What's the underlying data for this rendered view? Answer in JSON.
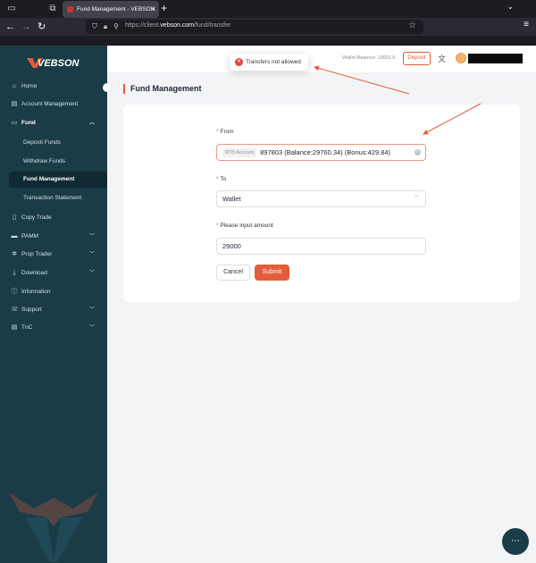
{
  "browser": {
    "tab_title": "Fund Management - VEBSON",
    "url_prefix": "https://client.",
    "url_domain": "vebson.com",
    "url_path": "/fund/transfer"
  },
  "sidebar": {
    "logo_text": "VEBSON",
    "items": [
      {
        "label": "Home",
        "icon": "home-icon"
      },
      {
        "label": "Account Management",
        "icon": "account-icon"
      },
      {
        "label": "Fund",
        "icon": "fund-icon",
        "expanded": true
      },
      {
        "label": "Deposit Funds"
      },
      {
        "label": "Withdraw Funds"
      },
      {
        "label": "Fund Management",
        "active": true
      },
      {
        "label": "Transaction Statement"
      },
      {
        "label": "Copy Trade",
        "icon": "copy-icon"
      },
      {
        "label": "PAMM",
        "icon": "pamm-icon"
      },
      {
        "label": "Prop Trader",
        "icon": "prop-icon"
      },
      {
        "label": "Download",
        "icon": "download-icon"
      },
      {
        "label": "Information",
        "icon": "info-icon"
      },
      {
        "label": "Support",
        "icon": "support-icon"
      },
      {
        "label": "TnC",
        "icon": "tnc-icon"
      }
    ]
  },
  "header": {
    "wallet_balance": "Wallet Balance: 10601.6",
    "deposit_label": "Deposit",
    "user_name": "redacted"
  },
  "toast": {
    "message": "Transfers not allowed"
  },
  "page": {
    "title": "Fund Management"
  },
  "form": {
    "from_label": "From",
    "from_tag": "MT5 Account",
    "from_value": "897803  (Balance:29760.34)  (Bonus:429.84)",
    "to_label": "To",
    "to_value": "Wallet",
    "amount_label": "Please input amount",
    "amount_value": "29000",
    "cancel_label": "Cancel",
    "submit_label": "Submit"
  },
  "colors": {
    "accent": "#e35c3a",
    "sidebar_bg": "#1a3c47",
    "error": "#e8453c"
  }
}
